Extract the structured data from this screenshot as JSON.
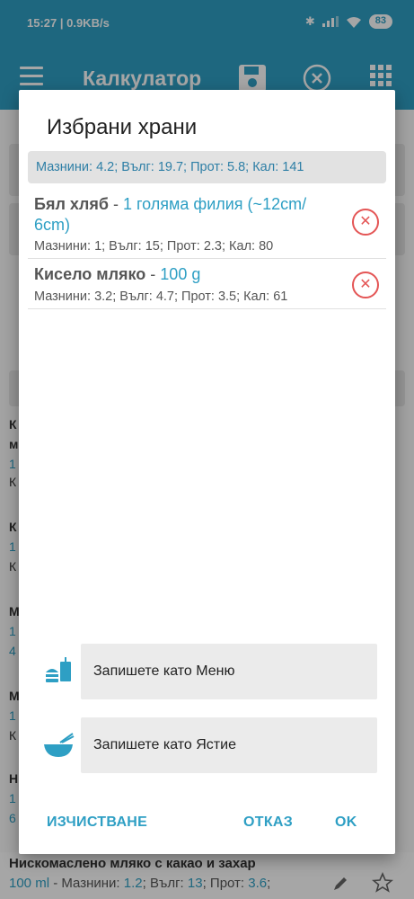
{
  "statusbar": {
    "time": "15:27 | 0.9KB/s",
    "battery": "83"
  },
  "appbar": {
    "title": "Калкулатор"
  },
  "dialog": {
    "title": "Избрани храни",
    "summary": "Мазнини: 4.2; Вълг: 19.7; Прот: 5.8; Кал: 141",
    "foods": [
      {
        "name": "Бял хляб",
        "sep": " - ",
        "portion": "1 голяма филия (~12cm/ 6cm)",
        "macros": "Мазнини: 1; Вълг: 15; Прот: 2.3; Кал: 80"
      },
      {
        "name": "Кисело мляко",
        "sep": " - ",
        "portion": "100 g",
        "macros": "Мазнини: 3.2; Вълг: 4.7; Прот: 3.5; Кал: 61"
      }
    ],
    "save_menu": "Запишете като Меню",
    "save_dish": "Запишете като Ястие",
    "clear": "ИЗЧИСТВАНЕ",
    "cancel": "ОТКАЗ",
    "ok": "OK"
  },
  "background": {
    "bottom_name": "Нискомаслено мляко с какао и захар",
    "bottom_qty": "100 ml",
    "bottom_sep": " - Мазнини: ",
    "bottom_fat": "1.2",
    "bottom_carb_label": "; Вълг: ",
    "bottom_carb": "13",
    "bottom_prot_label": "; Прот: ",
    "bottom_prot": "3.6",
    "bottom_end": ";",
    "fragments": [
      "К",
      "м",
      "1",
      "К",
      "К",
      "1",
      "К",
      "М",
      "1",
      "4",
      "М",
      "1",
      "К",
      "Н",
      "1",
      "6"
    ]
  },
  "colors": {
    "accent": "#2e9fc4",
    "delete": "#e45555"
  }
}
